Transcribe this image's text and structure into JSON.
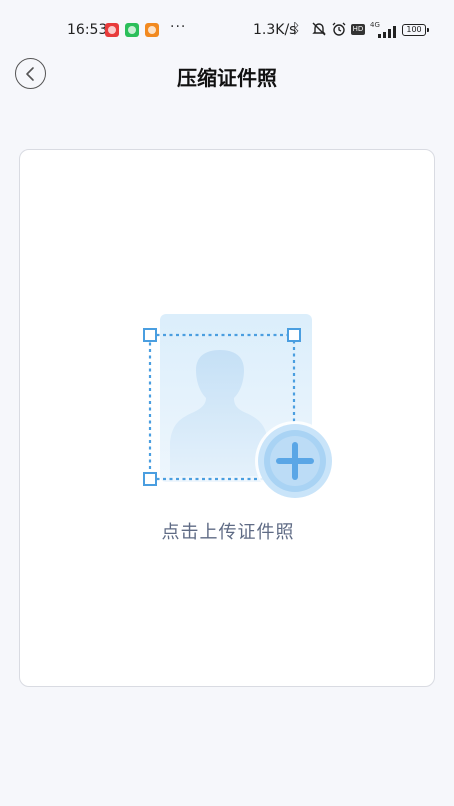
{
  "status_bar": {
    "time": "16:53",
    "more": "···",
    "network_speed": "1.3K/s",
    "hd_badge": "HD",
    "cellular": "4G",
    "battery": "100",
    "app_icons": [
      "netease-music-icon",
      "wechat-icon",
      "mi-icon"
    ]
  },
  "header": {
    "title": "压缩证件照",
    "back_icon": "chevron-left-icon"
  },
  "upload": {
    "hint": "点击上传证件照",
    "illustration_icon": "id-photo-plus-icon"
  },
  "colors": {
    "accent": "#5aa6e6",
    "hint_text": "#5f6b85",
    "page_bg": "#f6f7fb"
  }
}
